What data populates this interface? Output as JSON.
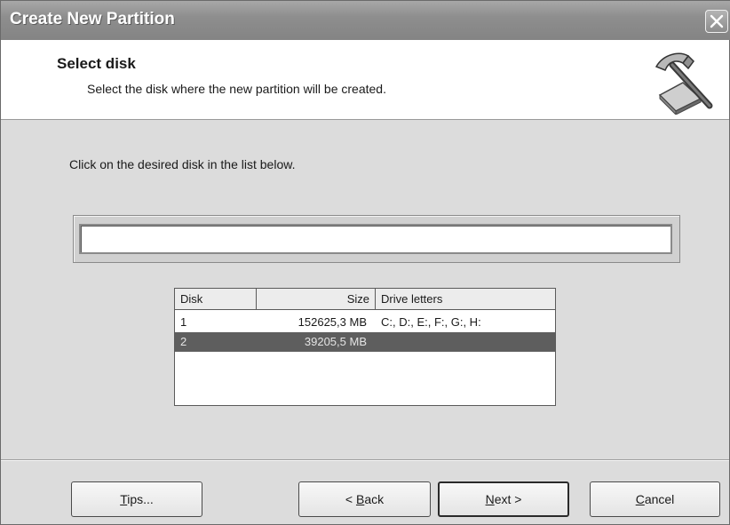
{
  "window": {
    "title": "Create New Partition"
  },
  "header": {
    "title": "Select disk",
    "subtitle": "Select the disk where the new partition will be created."
  },
  "icons": {
    "close": "close-icon",
    "wizard": "hammer-disk-icon"
  },
  "instruction": "Click on the desired disk in the list below.",
  "disk_list": {
    "columns": [
      "Disk",
      "Size",
      "Drive letters"
    ],
    "rows": [
      {
        "disk": "1",
        "size": "152625,3 MB",
        "letters": "C:, D:, E:, F:, G:, H:",
        "selected": false
      },
      {
        "disk": "2",
        "size": "39205,5 MB",
        "letters": "",
        "selected": true
      }
    ]
  },
  "buttons": {
    "tips": {
      "mnemonic": "T",
      "rest": "ips..."
    },
    "back": {
      "pre": "< ",
      "mnemonic": "B",
      "rest": "ack"
    },
    "next": {
      "mnemonic": "N",
      "rest": "ext >"
    },
    "cancel": {
      "mnemonic": "C",
      "rest": "ancel"
    }
  }
}
